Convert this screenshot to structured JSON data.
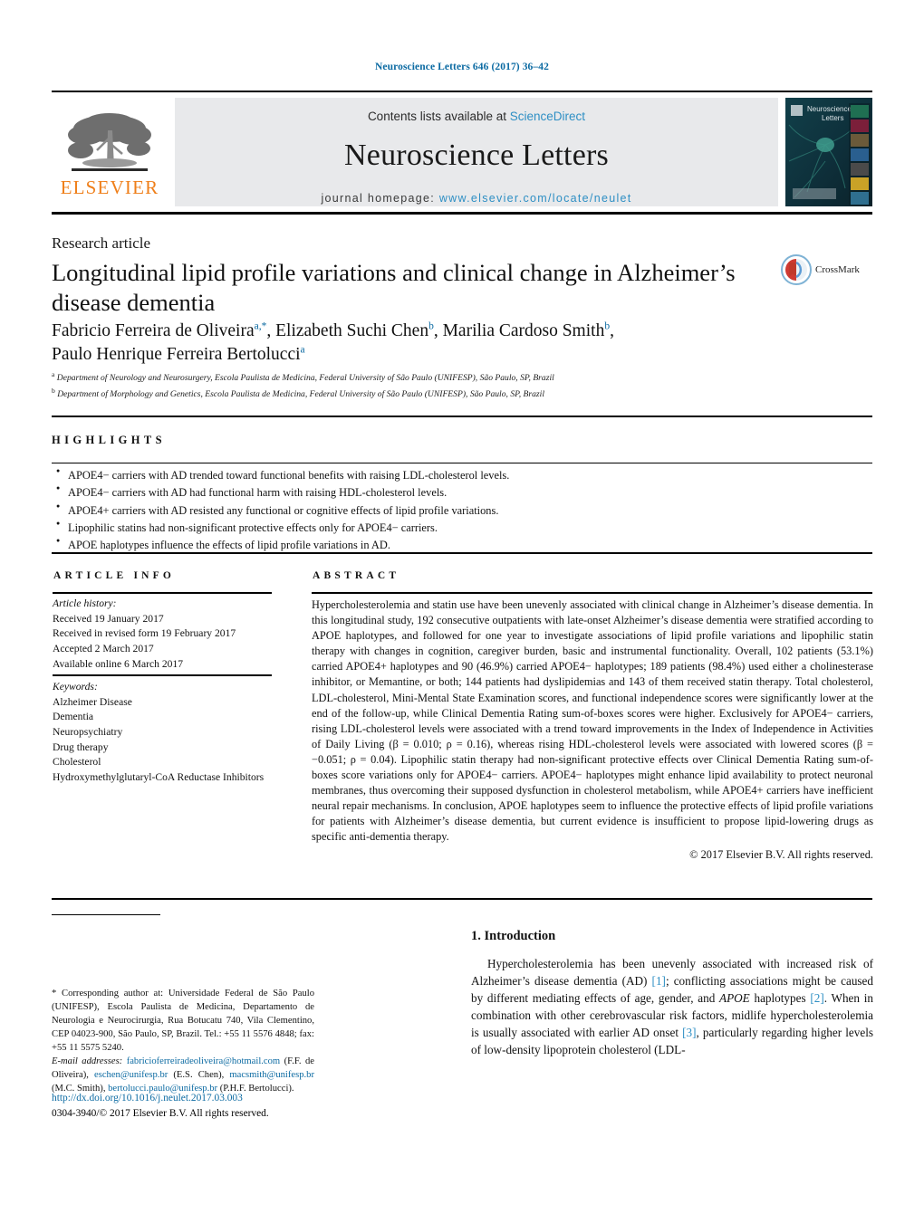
{
  "running_head": "Neuroscience Letters 646 (2017) 36–42",
  "masthead": {
    "contents_prefix": "Contents lists available at ",
    "sciencedirect": "ScienceDirect",
    "journal_name": "Neuroscience Letters",
    "homepage_prefix": "journal homepage: ",
    "homepage_url": "www.elsevier.com/locate/neulet",
    "publisher_wordmark": "ELSEVIER",
    "cover_title_line1": "Neuroscience",
    "cover_title_line2": "Letters",
    "accent_blue": "#2e8fc4",
    "elsevier_orange": "#ef7f1a"
  },
  "article": {
    "type": "Research article",
    "title": "Longitudinal lipid profile variations and clinical change in Alzheimer’s disease dementia",
    "crossmark_label": "CrossMark",
    "authors": [
      {
        "name": "Fabricio Ferreira de Oliveira",
        "marks": "a,*"
      },
      {
        "name": "Elizabeth Suchi Chen",
        "marks": "b"
      },
      {
        "name": "Marilia Cardoso Smith",
        "marks": "b"
      },
      {
        "name": "Paulo Henrique Ferreira Bertolucci",
        "marks": "a"
      }
    ],
    "affiliations": [
      {
        "mark": "a",
        "text": "Department of Neurology and Neurosurgery, Escola Paulista de Medicina, Federal University of São Paulo (UNIFESP), São Paulo, SP, Brazil"
      },
      {
        "mark": "b",
        "text": "Department of Morphology and Genetics, Escola Paulista de Medicina, Federal University of São Paulo (UNIFESP), São Paulo, SP, Brazil"
      }
    ]
  },
  "highlights": {
    "heading": "HIGHLIGHTS",
    "items": [
      "APOE4− carriers with AD trended toward functional benefits with raising LDL-cholesterol levels.",
      "APOE4− carriers with AD had functional harm with raising HDL-cholesterol levels.",
      "APOE4+ carriers with AD resisted any functional or cognitive effects of lipid profile variations.",
      "Lipophilic statins had non-significant protective effects only for APOE4− carriers.",
      "APOE haplotypes influence the effects of lipid profile variations in AD."
    ]
  },
  "article_info": {
    "heading": "ARTICLE INFO",
    "history_label": "Article history:",
    "history": [
      "Received 19 January 2017",
      "Received in revised form 19 February 2017",
      "Accepted 2 March 2017",
      "Available online 6 March 2017"
    ],
    "keywords_label": "Keywords:",
    "keywords": [
      "Alzheimer Disease",
      "Dementia",
      "Neuropsychiatry",
      "Drug therapy",
      "Cholesterol",
      "Hydroxymethylglutaryl-CoA Reductase Inhibitors"
    ]
  },
  "abstract": {
    "heading": "ABSTRACT",
    "text": "Hypercholesterolemia and statin use have been unevenly associated with clinical change in Alzheimer’s disease dementia. In this longitudinal study, 192 consecutive outpatients with late-onset Alzheimer’s disease dementia were stratified according to APOE haplotypes, and followed for one year to investigate associations of lipid profile variations and lipophilic statin therapy with changes in cognition, caregiver burden, basic and instrumental functionality. Overall, 102 patients (53.1%) carried APOE4+ haplotypes and 90 (46.9%) carried APOE4− haplotypes; 189 patients (98.4%) used either a cholinesterase inhibitor, or Memantine, or both; 144 patients had dyslipidemias and 143 of them received statin therapy. Total cholesterol, LDL-cholesterol, Mini-Mental State Examination scores, and functional independence scores were significantly lower at the end of the follow-up, while Clinical Dementia Rating sum-of-boxes scores were higher. Exclusively for APOE4− carriers, rising LDL-cholesterol levels were associated with a trend toward improvements in the Index of Independence in Activities of Daily Living (β = 0.010; ρ = 0.16), whereas rising HDL-cholesterol levels were associated with lowered scores (β = −0.051; ρ = 0.04). Lipophilic statin therapy had non-significant protective effects over Clinical Dementia Rating sum-of-boxes score variations only for APOE4− carriers. APOE4− haplotypes might enhance lipid availability to protect neuronal membranes, thus overcoming their supposed dysfunction in cholesterol metabolism, while APOE4+ carriers have inefficient neural repair mechanisms. In conclusion, APOE haplotypes seem to influence the protective effects of lipid profile variations for patients with Alzheimer’s disease dementia, but current evidence is insufficient to propose lipid-lowering drugs as specific anti-dementia therapy.",
    "copyright": "© 2017 Elsevier B.V. All rights reserved."
  },
  "footnote": {
    "corresponding": "* Corresponding author at: Universidade Federal de São Paulo (UNIFESP), Escola Paulista de Medicina, Departamento de Neurologia e Neurocirurgia, Rua Botucatu 740, Vila Clementino, CEP 04023-900, São Paulo, SP, Brazil. Tel.: +55 11 5576 4848; fax: +55 11 5575 5240.",
    "email_label": "E-mail addresses:",
    "emails": [
      {
        "address": "fabricioferreiradeoliveira@hotmail.com",
        "owner": "(F.F. de Oliveira)"
      },
      {
        "address": "eschen@unifesp.br",
        "owner": "(E.S. Chen)"
      },
      {
        "address": "macsmith@unifesp.br",
        "owner": "(M.C. Smith)"
      },
      {
        "address": "bertolucci.paulo@unifesp.br",
        "owner": "(P.H.F. Bertolucci)"
      }
    ],
    "doi": "http://dx.doi.org/10.1016/j.neulet.2017.03.003",
    "issn_line": "0304-3940/© 2017 Elsevier B.V. All rights reserved."
  },
  "introduction": {
    "heading": "1.  Introduction",
    "paragraph_parts": [
      "Hypercholesterolemia has been unevenly associated with increased risk of Alzheimer’s disease dementia (AD) ",
      "[1]",
      "; conflicting associations might be caused by different mediating effects of age, gender, and ",
      "APOE",
      " haplotypes ",
      "[2]",
      ". When in combination with other cerebrovascular risk factors, midlife hypercholesterolemia is usually associated with earlier AD onset ",
      "[3]",
      ", particularly regarding higher levels of low-density lipoprotein cholesterol (LDL-"
    ]
  }
}
